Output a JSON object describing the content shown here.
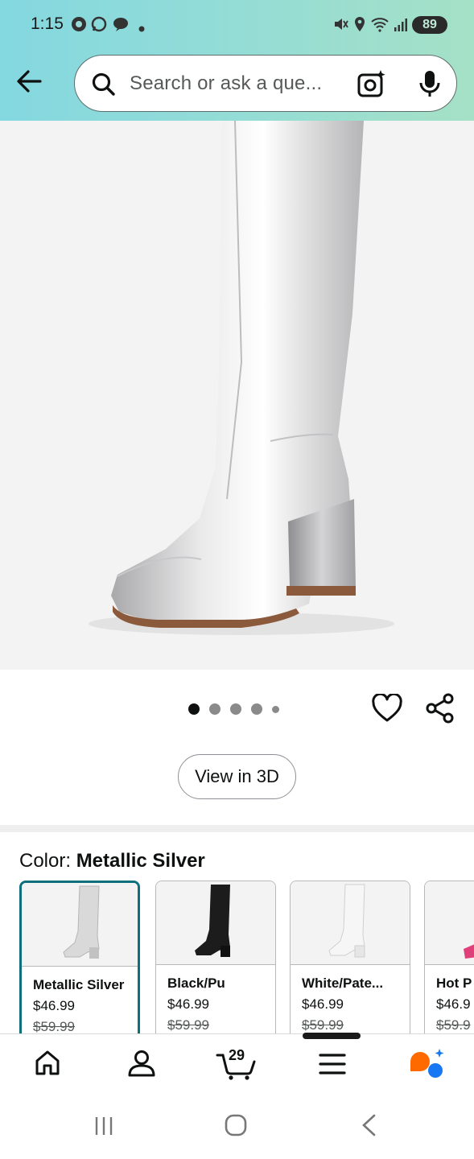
{
  "status_bar": {
    "time": "1:15",
    "battery": "89"
  },
  "search": {
    "placeholder": "Search or ask a que..."
  },
  "product_image": {
    "indicator": {
      "total": 5,
      "active_index": 0
    }
  },
  "actions": {
    "view_3d_label": "View in 3D"
  },
  "color_selector": {
    "label": "Color: ",
    "selected": "Metallic Silver",
    "options": [
      {
        "name": "Metallic Silver",
        "price": "$46.99",
        "list_price": "$59.99",
        "selected": true,
        "boot_color": "#d9d9d9"
      },
      {
        "name": "Black/Pu",
        "price": "$46.99",
        "list_price": "$59.99",
        "selected": false,
        "boot_color": "#1c1c1c"
      },
      {
        "name": "White/Pate...",
        "price": "$46.99",
        "list_price": "$59.99",
        "selected": false,
        "boot_color": "#f0f0f0"
      },
      {
        "name": "Hot P",
        "price": "$46.9",
        "list_price": "$59.9",
        "selected": false,
        "boot_color": "#e0407a"
      }
    ]
  },
  "bottom_nav": {
    "cart_count": "29",
    "items": [
      "home-icon",
      "account-icon",
      "cart-icon",
      "menu-icon",
      "rufus-icon"
    ]
  },
  "colors": {
    "header_gradient_start": "#84d8e0",
    "header_gradient_end": "#a5e1c6",
    "selected_border": "#0e6f7d"
  }
}
